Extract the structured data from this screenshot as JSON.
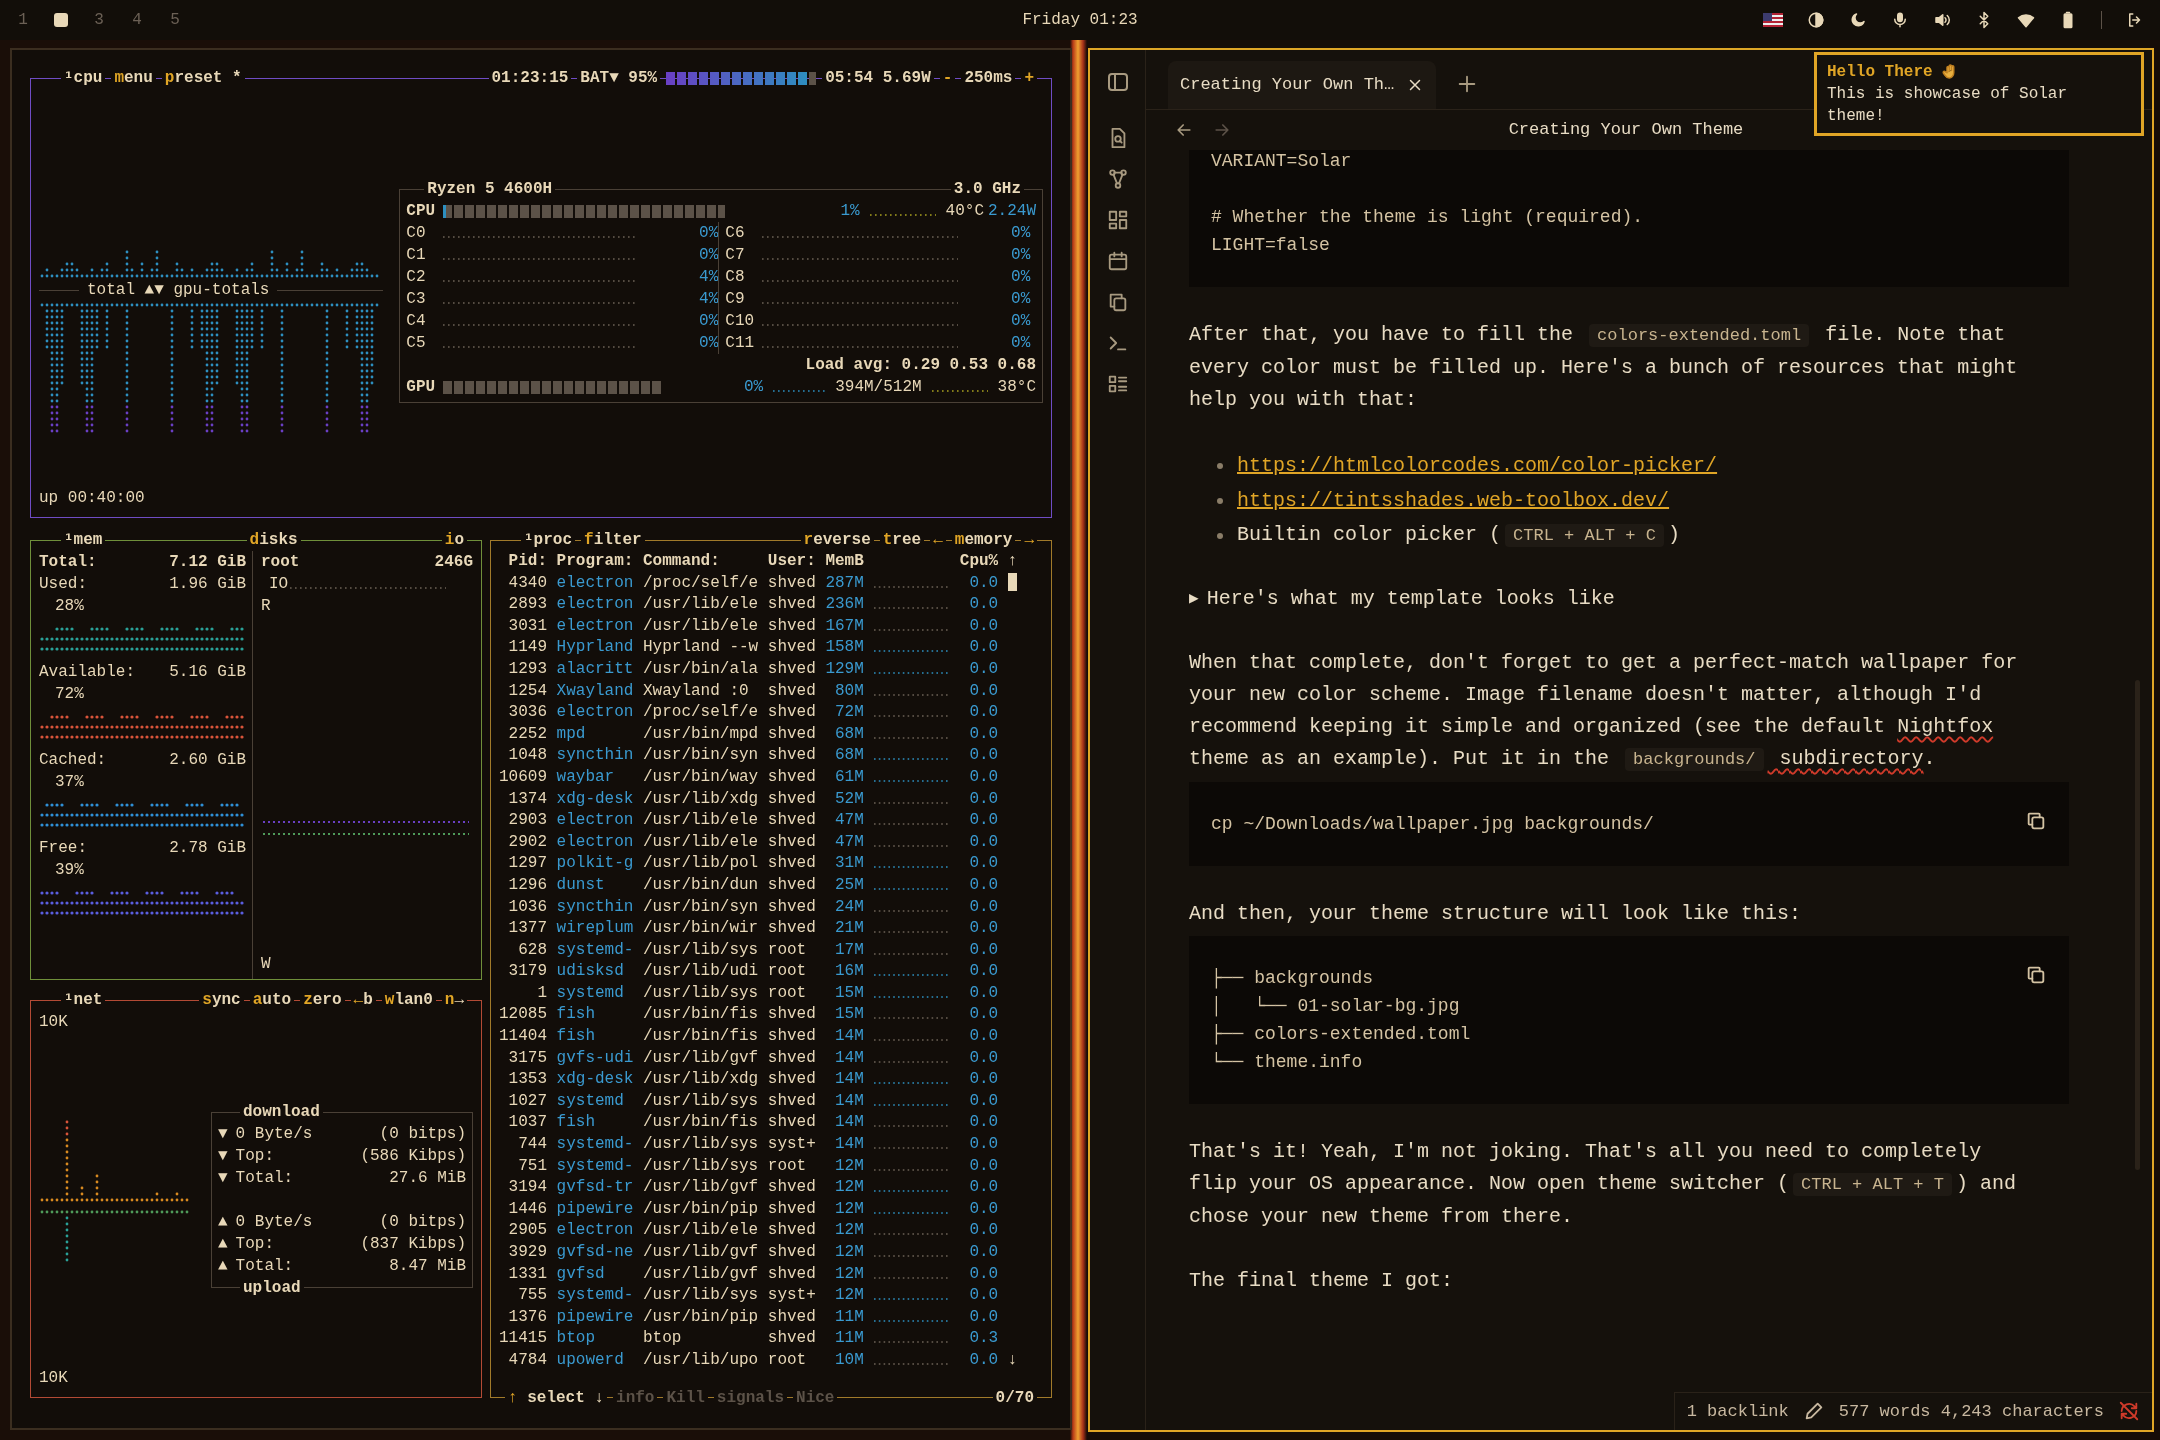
{
  "top_bar": {
    "workspaces": [
      {
        "label": "1",
        "selected": false
      },
      {
        "selected": true
      },
      {
        "label": "3",
        "selected": false
      },
      {
        "label": "4",
        "selected": false
      },
      {
        "label": "5",
        "selected": false
      }
    ],
    "clock": "Friday 01:23"
  },
  "btop": {
    "cpu": {
      "title": "¹cpu",
      "buttons": [
        "menu",
        "preset *"
      ],
      "clock": "01:23:15",
      "battery": {
        "label": "BAT▼ 95%",
        "level": 0.95,
        "reading": "05:54 5.69W"
      },
      "interval": {
        "decrease": "-",
        "value": "250ms",
        "increase": "+"
      },
      "graph_label": "total ▲▼ gpu-totals",
      "uptime": "up 00:40:00",
      "info": {
        "model": "Ryzen 5 4600H",
        "frequency": "3.0 GHz",
        "cpu": {
          "label": "CPU",
          "level": 0.01,
          "reading": "1%",
          "temperature": "40°C",
          "power": "2.24W"
        },
        "cores": [
          {
            "name": "C0",
            "reading": "0%"
          },
          {
            "name": "C1",
            "reading": "0%"
          },
          {
            "name": "C2",
            "reading": "4%"
          },
          {
            "name": "C3",
            "reading": "4%"
          },
          {
            "name": "C4",
            "reading": "0%"
          },
          {
            "name": "C5",
            "reading": "0%"
          },
          {
            "name": "C6",
            "reading": "0%"
          },
          {
            "name": "C7",
            "reading": "0%"
          },
          {
            "name": "C8",
            "reading": "0%"
          },
          {
            "name": "C9",
            "reading": "0%"
          },
          {
            "name": "C10",
            "reading": "0%"
          },
          {
            "name": "C11",
            "reading": "0%"
          }
        ],
        "load": "Load avg: 0.29 0.53 0.68",
        "gpu": {
          "label": "GPU",
          "level": 0,
          "reading": "0%",
          "memory": "394M/512M",
          "temperature": "38°C"
        }
      }
    },
    "mem": {
      "title": "¹mem",
      "total": {
        "label": "Total:",
        "value": "7.12 GiB"
      },
      "items": [
        {
          "label": "Used:",
          "value": "1.96 GiB",
          "percent": "28%",
          "color": "#2aa198"
        },
        {
          "label": "Available:",
          "value": "5.16 GiB",
          "percent": "72%",
          "color": "#d9543a"
        },
        {
          "label": "Cached:",
          "value": "2.60 GiB",
          "percent": "37%",
          "color": "#2f8fd6"
        },
        {
          "label": "Free:",
          "value": "2.78 GiB",
          "percent": "39%",
          "color": "#5a5ee0"
        }
      ]
    },
    "disks": {
      "title": "disks",
      "button": "io",
      "name": "root",
      "size": "246G",
      "io": "IO",
      "read": "R",
      "write": "W"
    },
    "net": {
      "title": "¹net",
      "buttons": [
        "sync",
        "auto",
        "zero",
        "←b",
        "wlan0",
        "n→"
      ],
      "scale_top": "10K",
      "scale_bottom": "10K",
      "download": {
        "title": "download",
        "rows": [
          {
            "arrow": "▼",
            "label": "0 Byte/s",
            "value": "(0 bitps)"
          },
          {
            "arrow": "▼",
            "label": "Top:",
            "value": "(586 Kibps)"
          },
          {
            "arrow": "▼",
            "label": "Total:",
            "value": "27.6 MiB"
          }
        ]
      },
      "upload": {
        "title": "upload",
        "rows": [
          {
            "arrow": "▲",
            "label": "0 Byte/s",
            "value": "(0 bitps)"
          },
          {
            "arrow": "▲",
            "label": "Top:",
            "value": "(837 Kibps)"
          },
          {
            "arrow": "▲",
            "label": "Total:",
            "value": "8.47 MiB"
          }
        ]
      }
    },
    "proc": {
      "title": "¹proc",
      "buttons": [
        "filter",
        "reverse",
        "tree",
        "←",
        "memory",
        "→"
      ],
      "columns": [
        "Pid:",
        "Program:",
        "Command:",
        "User:",
        "MemB",
        "Cpu%"
      ],
      "sort_indicator": "↑",
      "scroll_down": "↓",
      "rows": [
        [
          "4340",
          "electron",
          "/proc/self/e",
          "shved",
          "287M",
          "0.0"
        ],
        [
          "2893",
          "electron",
          "/usr/lib/ele",
          "shved",
          "236M",
          "0.0"
        ],
        [
          "3031",
          "electron",
          "/usr/lib/ele",
          "shved",
          "167M",
          "0.0"
        ],
        [
          "1149",
          "Hyprland",
          "Hyprland --w",
          "shved",
          "158M",
          "0.0"
        ],
        [
          "1293",
          "alacritt",
          "/usr/bin/ala",
          "shved",
          "129M",
          "0.0"
        ],
        [
          "1254",
          "Xwayland",
          "Xwayland :0",
          "shved",
          "80M",
          "0.0"
        ],
        [
          "3036",
          "electron",
          "/proc/self/e",
          "shved",
          "72M",
          "0.0"
        ],
        [
          "2252",
          "mpd",
          "/usr/bin/mpd",
          "shved",
          "68M",
          "0.0"
        ],
        [
          "1048",
          "syncthin",
          "/usr/bin/syn",
          "shved",
          "68M",
          "0.0"
        ],
        [
          "10609",
          "waybar",
          "/usr/bin/way",
          "shved",
          "61M",
          "0.0"
        ],
        [
          "1374",
          "xdg-desk",
          "/usr/lib/xdg",
          "shved",
          "52M",
          "0.0"
        ],
        [
          "2903",
          "electron",
          "/usr/lib/ele",
          "shved",
          "47M",
          "0.0"
        ],
        [
          "2902",
          "electron",
          "/usr/lib/ele",
          "shved",
          "47M",
          "0.0"
        ],
        [
          "1297",
          "polkit-g",
          "/usr/lib/pol",
          "shved",
          "31M",
          "0.0"
        ],
        [
          "1296",
          "dunst",
          "/usr/bin/dun",
          "shved",
          "25M",
          "0.0"
        ],
        [
          "1036",
          "syncthin",
          "/usr/bin/syn",
          "shved",
          "24M",
          "0.0"
        ],
        [
          "1377",
          "wireplum",
          "/usr/bin/wir",
          "shved",
          "21M",
          "0.0"
        ],
        [
          "628",
          "systemd-",
          "/usr/lib/sys",
          "root",
          "17M",
          "0.0"
        ],
        [
          "3179",
          "udisksd",
          "/usr/lib/udi",
          "root",
          "16M",
          "0.0"
        ],
        [
          "1",
          "systemd",
          "/usr/lib/sys",
          "root",
          "15M",
          "0.0"
        ],
        [
          "12085",
          "fish",
          "/usr/bin/fis",
          "shved",
          "15M",
          "0.0"
        ],
        [
          "11404",
          "fish",
          "/usr/bin/fis",
          "shved",
          "14M",
          "0.0"
        ],
        [
          "3175",
          "gvfs-udi",
          "/usr/lib/gvf",
          "shved",
          "14M",
          "0.0"
        ],
        [
          "1353",
          "xdg-desk",
          "/usr/lib/xdg",
          "shved",
          "14M",
          "0.0"
        ],
        [
          "1027",
          "systemd",
          "/usr/lib/sys",
          "shved",
          "14M",
          "0.0"
        ],
        [
          "1037",
          "fish",
          "/usr/bin/fis",
          "shved",
          "14M",
          "0.0"
        ],
        [
          "744",
          "systemd-",
          "/usr/lib/sys",
          "syst+",
          "14M",
          "0.0"
        ],
        [
          "751",
          "systemd-",
          "/usr/lib/sys",
          "root",
          "12M",
          "0.0"
        ],
        [
          "3194",
          "gvfsd-tr",
          "/usr/lib/gvf",
          "shved",
          "12M",
          "0.0"
        ],
        [
          "1446",
          "pipewire",
          "/usr/bin/pip",
          "shved",
          "12M",
          "0.0"
        ],
        [
          "2905",
          "electron",
          "/usr/lib/ele",
          "shved",
          "12M",
          "0.0"
        ],
        [
          "3929",
          "gvfsd-ne",
          "/usr/lib/gvf",
          "shved",
          "12M",
          "0.0"
        ],
        [
          "1331",
          "gvfsd",
          "/usr/lib/gvf",
          "shved",
          "12M",
          "0.0"
        ],
        [
          "755",
          "systemd-",
          "/usr/lib/sys",
          "syst+",
          "12M",
          "0.0"
        ],
        [
          "1376",
          "pipewire",
          "/usr/bin/pip",
          "shved",
          "11M",
          "0.0"
        ],
        [
          "11415",
          "btop",
          "btop",
          "shved",
          "11M",
          "0.3"
        ],
        [
          "4784",
          "upowerd",
          "/usr/lib/upo",
          "root",
          "10M",
          "0.0"
        ]
      ],
      "footer": [
        {
          "label": "↑ select ↓",
          "disabled": false
        },
        {
          "label": "info",
          "disabled": true
        },
        {
          "label": "Kill",
          "disabled": true
        },
        {
          "label": "signals",
          "disabled": true
        },
        {
          "label": "Nice",
          "disabled": true
        }
      ],
      "count": "0/70"
    }
  },
  "editor": {
    "tab": {
      "title": "Creating Your Own Th…",
      "selected": true
    },
    "title": "Creating Your Own Theme",
    "toast": {
      "title": "Hello There",
      "message": "This is showcase of Solar theme!"
    },
    "blocks": [
      {
        "kind": "code",
        "groups": [
          [
            "VARIANT=Solar"
          ],
          [
            "# Whether the theme is light (required).",
            "LIGHT=false"
          ]
        ]
      },
      {
        "kind": "paragraph",
        "segments": [
          {
            "kind": "text",
            "text": "After that, you have to fill the "
          },
          {
            "kind": "code",
            "text": "colors-extended.toml"
          },
          {
            "kind": "text",
            "text": " file. Note that every color must be filled up. Here's a bunch of resources that might help you with that:"
          }
        ]
      },
      {
        "kind": "list",
        "items": [
          [
            {
              "kind": "link",
              "text": "https://htmlcolorcodes.com/color-picker/"
            }
          ],
          [
            {
              "kind": "link",
              "text": "https://tintsshades.web-toolbox.dev/"
            }
          ],
          [
            {
              "kind": "text",
              "text": "Builtin color picker ("
            },
            {
              "kind": "code",
              "text": "CTRL + ALT + C"
            },
            {
              "kind": "text",
              "text": ")"
            }
          ]
        ]
      },
      {
        "kind": "details",
        "marker": "▶",
        "text": "Here's what my template looks like",
        "expanded": false
      },
      {
        "kind": "paragraph",
        "segments": [
          {
            "kind": "text",
            "text": "When that complete, don't forget to get a perfect-match wallpaper for your new color scheme. Image filename doesn't matter, although I'd recommend keeping it simple and organized (see the default "
          },
          {
            "kind": "misspelled",
            "text": "Nightfox"
          },
          {
            "kind": "text",
            "text": " theme as an example). Put it in the "
          },
          {
            "kind": "code",
            "text": "backgrounds/"
          },
          {
            "kind": "misspelled",
            "text": " subdirectory"
          },
          {
            "kind": "text",
            "text": "."
          }
        ]
      },
      {
        "kind": "code",
        "copy": true,
        "groups": [
          [
            "cp ~/Downloads/wallpaper.jpg backgrounds/"
          ]
        ]
      },
      {
        "kind": "paragraph",
        "segments": [
          {
            "kind": "text",
            "text": "And then, your theme structure will look like this:"
          }
        ]
      },
      {
        "kind": "code",
        "copy": true,
        "groups": [
          [
            "├── backgrounds",
            "│   └── 01-solar-bg.jpg",
            "├── colors-extended.toml",
            "└── theme.info"
          ]
        ]
      },
      {
        "kind": "paragraph",
        "segments": [
          {
            "kind": "text",
            "text": "That's it! Yeah, I'm not joking. That's all you need to completely flip your OS appearance. Now open theme switcher ("
          },
          {
            "kind": "code",
            "text": "CTRL + ALT + T"
          },
          {
            "kind": "text",
            "text": ") and chose your new theme from there."
          }
        ]
      },
      {
        "kind": "paragraph",
        "segments": [
          {
            "kind": "text",
            "text": "The final theme I got:"
          }
        ]
      }
    ],
    "status_bar": {
      "backlinks": "1 backlink",
      "counts": "577 words 4,243 characters"
    }
  }
}
